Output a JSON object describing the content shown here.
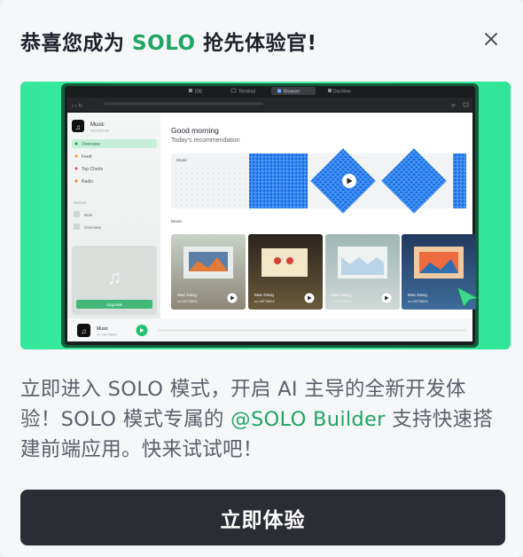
{
  "dialog": {
    "title_pre": "恭喜您成为 ",
    "title_highlight": "SOLO",
    "title_post": " 抢先体验官!",
    "close_icon": "close-icon",
    "description_pre": "立即进入 SOLO 模式，开启 AI 主导的全新开发体验！SOLO 模式专属的 ",
    "description_highlight": "@SOLO Builder",
    "description_post": " 支持快速搭建前端应用。快来试试吧！",
    "cta_label": "立即体验",
    "accent_color": "#1fa565"
  },
  "preview": {
    "tabs": [
      "IDE",
      "Terminal",
      "Browser",
      "DocView"
    ],
    "app_name": "Music",
    "app_subtitle": "NE2S8GO8P",
    "nav": [
      "Overview",
      "Feed",
      "Top Charts",
      "Radio"
    ],
    "recent_label": "Recent",
    "recent_items": [
      "New",
      "Overview"
    ],
    "upgrade_label": "Upgrade",
    "greeting": "Good morning",
    "sub_greeting": "Today's recommendation",
    "banner_label": "Music",
    "section_label": "Music",
    "cards": [
      {
        "title": "Mac Dang",
        "subtitle": "no.24ETB8SA"
      },
      {
        "title": "Mac Dang",
        "subtitle": "no.24ETB8SA"
      },
      {
        "title": "Mac Dang",
        "subtitle": "no.24ETB8SA"
      },
      {
        "title": "Mac Dang",
        "subtitle": "no.24ETB8SA"
      }
    ],
    "player_title": "Music",
    "player_subtitle": "no.24ETB8SA"
  }
}
